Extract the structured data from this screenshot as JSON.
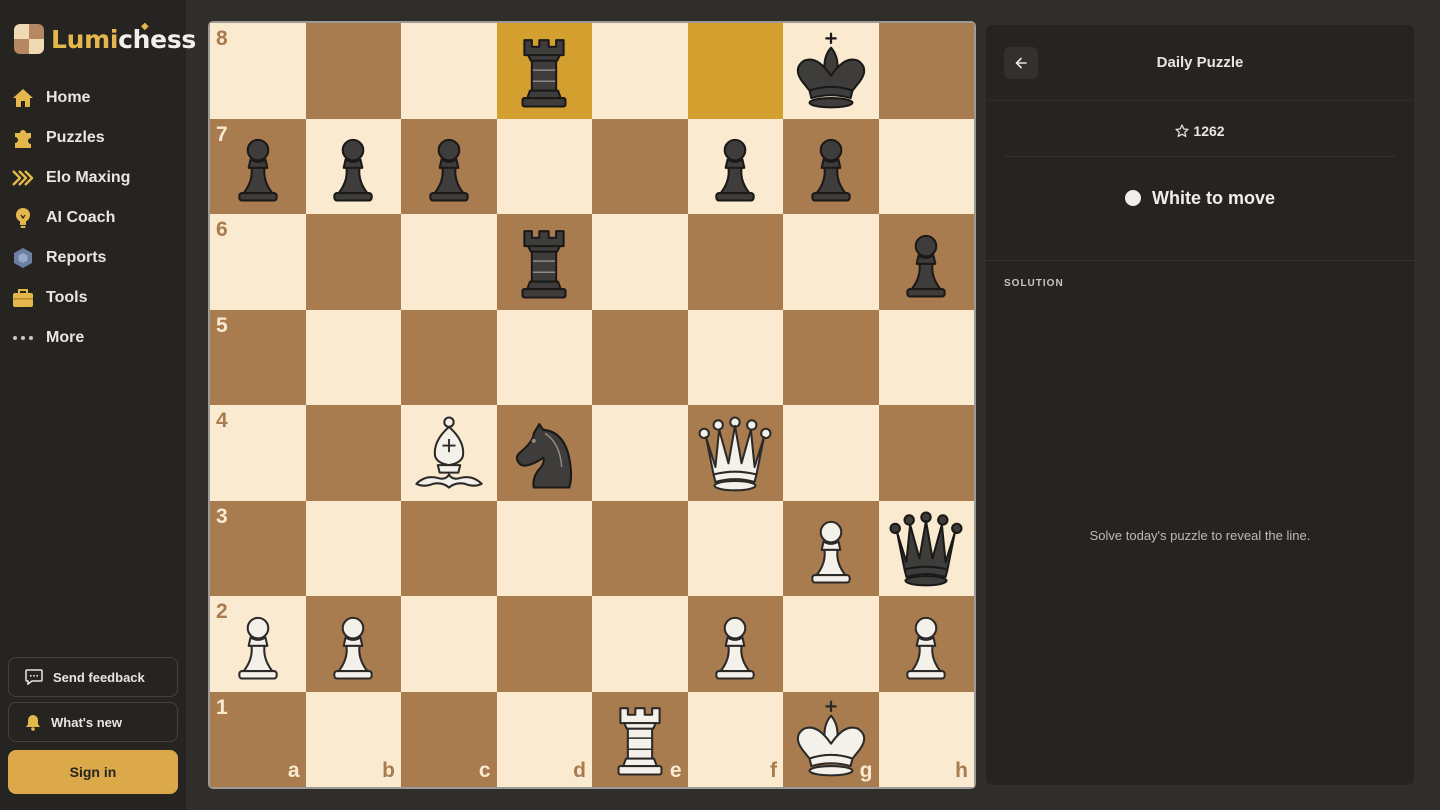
{
  "brand": {
    "name_part1": "Lumi",
    "name_part2": "chess"
  },
  "nav": [
    {
      "label": "Home",
      "icon": "home-icon"
    },
    {
      "label": "Puzzles",
      "icon": "puzzle-icon"
    },
    {
      "label": "Elo Maxing",
      "icon": "chevrons-right-icon"
    },
    {
      "label": "AI Coach",
      "icon": "lightbulb-icon"
    },
    {
      "label": "Reports",
      "icon": "hexagon-icon"
    },
    {
      "label": "Tools",
      "icon": "briefcase-icon"
    },
    {
      "label": "More",
      "icon": "dots-icon"
    }
  ],
  "footer": {
    "feedback_label": "Send feedback",
    "whats_new_label": "What's new",
    "signin_label": "Sign in"
  },
  "board": {
    "files": [
      "a",
      "b",
      "c",
      "d",
      "e",
      "f",
      "g",
      "h"
    ],
    "ranks": [
      "8",
      "7",
      "6",
      "5",
      "4",
      "3",
      "2",
      "1"
    ],
    "highlighted": [
      "d8",
      "f8"
    ],
    "pieces": {
      "d8": "bR",
      "g8": "bK",
      "a7": "bP",
      "b7": "bP",
      "c7": "bP",
      "f7": "bP",
      "g7": "bP",
      "d6": "bR",
      "h6": "bP",
      "c4": "wB",
      "d4": "bN",
      "f4": "wQ",
      "g3": "wP",
      "h3": "bQ",
      "a2": "wP",
      "b2": "wP",
      "f2": "wP",
      "h2": "wP",
      "e1": "wR",
      "g1": "wK"
    },
    "colors": {
      "light": "#f9ead0",
      "dark": "#a97c4f",
      "highlight": "#d3a030"
    }
  },
  "panel": {
    "title": "Daily Puzzle",
    "rating": "1262",
    "to_move": "White to move",
    "solution_label": "SOLUTION",
    "solution_placeholder": "Solve today's puzzle to reveal the line."
  },
  "accent": "#dba84a"
}
